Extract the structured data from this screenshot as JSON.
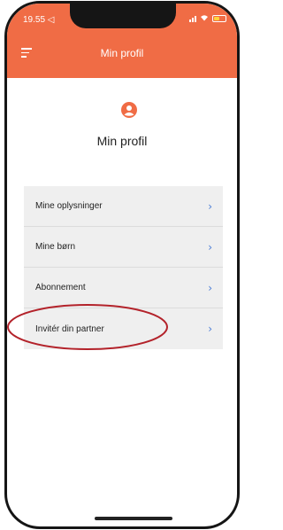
{
  "status_bar": {
    "time": "19.55 ◁"
  },
  "header": {
    "title": "Min profil",
    "color": "#f06c45"
  },
  "profile": {
    "title": "Min profil"
  },
  "menu": {
    "items": [
      {
        "label": "Mine oplysninger",
        "chevron": "›"
      },
      {
        "label": "Mine børn",
        "chevron": "›"
      },
      {
        "label": "Abonnement",
        "chevron": "›"
      },
      {
        "label": "Invitér din partner",
        "chevron": "›"
      }
    ]
  },
  "icons": [
    "hamburger-menu-icon",
    "profile-user-icon",
    "chevron-right-icon",
    "signal-icon",
    "wifi-icon",
    "battery-icon"
  ],
  "annotation": {
    "shape": "ellipse",
    "color": "#b3222a",
    "highlights": "Invitér din partner"
  }
}
